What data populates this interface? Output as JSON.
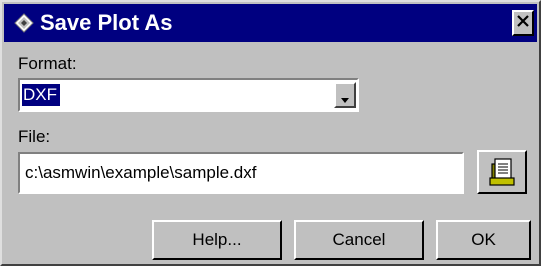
{
  "window": {
    "title": "Save Plot As",
    "title_icon": "diamond-app-icon",
    "close_icon": "close-x-icon",
    "titlebar_color": "#000080",
    "face_color": "#c0c0c0"
  },
  "format": {
    "label": "Format:",
    "selected": "DXF",
    "dropdown_icon": "chevron-down-icon"
  },
  "file": {
    "label": "File:",
    "value": "c:\\asmwin\\example\\sample.dxf",
    "browse_icon": "folder-document-icon"
  },
  "buttons": {
    "help": "Help...",
    "cancel": "Cancel",
    "ok": "OK"
  }
}
